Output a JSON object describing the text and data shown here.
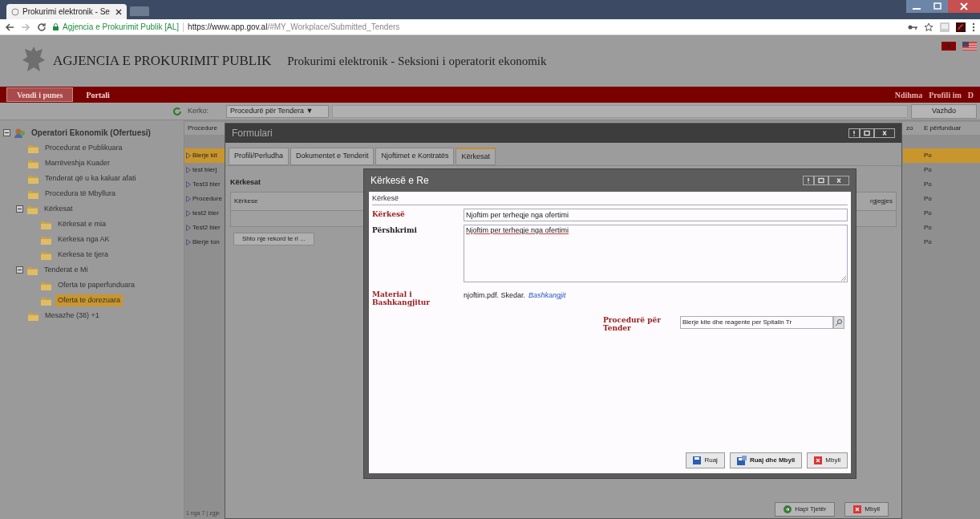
{
  "browser": {
    "tab_title": "Prokurimi elektronik - Se",
    "site_name": "Agjencia e Prokurimit Publik [AL]",
    "url_host": "https://www.app.gov.al",
    "url_path": "/#MY_Workplace/Submitted_Tenders"
  },
  "header": {
    "agency": "AGJENCIA E PROKURIMIT PUBLIK",
    "subtitle": "Prokurimi elektronik - Seksioni i operatorit ekonomik"
  },
  "nav": {
    "items": [
      {
        "label": "Vendi i punes",
        "selected": true
      },
      {
        "label": "Portali",
        "selected": false
      }
    ],
    "right_links": [
      "Ndihma",
      "Profili im",
      "D"
    ]
  },
  "toolbar": {
    "search_label": "Kerko:",
    "dropdown": "Procedurë për Tendera ▼",
    "go_button": "Vazhdo"
  },
  "sidebar": {
    "tree": [
      {
        "label": "Operatori Ekonomik (Ofertuesi)",
        "kind": "root",
        "expanded": true,
        "selected": false,
        "children": [
          {
            "label": "Procedurat e Publikuara",
            "selected": false
          },
          {
            "label": "Marrëveshja Kuader",
            "selected": false
          },
          {
            "label": "Tenderat që u ka kaluar afati",
            "selected": false
          },
          {
            "label": "Procedura të Mbyllura",
            "selected": false
          },
          {
            "label": "Kërkesat",
            "expanded": true,
            "selected": false,
            "children": [
              {
                "label": "Kërkesat e mia",
                "selected": false
              },
              {
                "label": "Kerkesa nga AK",
                "selected": false
              },
              {
                "label": "Kerkesa te tjera",
                "selected": false
              }
            ]
          },
          {
            "label": "Tenderat e Mi",
            "expanded": true,
            "selected": false,
            "children": [
              {
                "label": "Oferta te paperfunduara",
                "selected": false
              },
              {
                "label": "Oferta te dorezuara",
                "selected": true
              }
            ]
          },
          {
            "label": "Mesazhe (38) +1",
            "selected": false
          }
        ]
      }
    ]
  },
  "grid": {
    "columns": [
      "Procedure",
      "zo",
      "E përfunduar"
    ],
    "rows": [
      {
        "name": "Bierje kit",
        "done": "Po",
        "selected": true
      },
      {
        "name": "test bierj",
        "done": "Po",
        "selected": false
      },
      {
        "name": "Test3 bler",
        "done": "Po",
        "selected": false
      },
      {
        "name": "Procedure",
        "done": "Po",
        "selected": false
      },
      {
        "name": "test2 bler",
        "done": "Po",
        "selected": false
      },
      {
        "name": "Test2 bler",
        "done": "Po",
        "selected": false
      },
      {
        "name": "Blerje ton",
        "done": "Po",
        "selected": false
      }
    ],
    "pager": "1 nga 7 | zgje"
  },
  "form_window": {
    "title": "Formulari",
    "tabs": [
      {
        "label": "Profili/Perludha",
        "selected": false
      },
      {
        "label": "Dokumentet e Tenderit",
        "selected": false
      },
      {
        "label": "Njoftimet e Kontratës",
        "selected": false
      },
      {
        "label": "Kërkesat",
        "selected": true
      }
    ],
    "section": "Kërkesat",
    "table_columns": [
      "Kërkese",
      "rgjegjes"
    ],
    "add_button": "Shto nje rekord te ri ...",
    "buttons": [
      {
        "label": "Hapi Tjetër",
        "kind": "next"
      },
      {
        "label": "Mbyll",
        "kind": "close"
      }
    ]
  },
  "dialog": {
    "title": "Kërkesë e Re",
    "section": "Kërkesë",
    "fields": [
      {
        "kind": "input",
        "label": "Kërkesë",
        "required": true,
        "value": "Njoftim per terheqje nga ofertimi"
      },
      {
        "kind": "textarea",
        "label": "Përshkrimi",
        "required": false,
        "value": "Njoftim per terheqje nga ofertimi"
      },
      {
        "kind": "attachment",
        "label": "Material i Bashkangjitur",
        "required": true,
        "value": "njoftim.pdf. Skedar.",
        "link": "Bashkangjit"
      },
      {
        "kind": "lookup",
        "label": "Procedurë për Tender",
        "required": true,
        "value": "Blerje kite dhe reagente per Spitalin Tr"
      }
    ],
    "buttons": [
      {
        "label": "Ruaj",
        "kind": "save"
      },
      {
        "label": "Ruaj dhe Mbyll",
        "kind": "save_close"
      },
      {
        "label": "Mbyll",
        "kind": "close"
      }
    ]
  }
}
